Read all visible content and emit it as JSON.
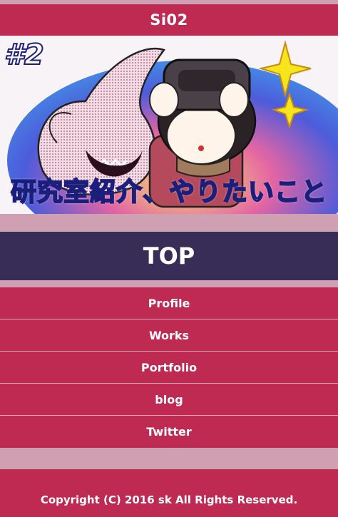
{
  "site": {
    "title": "Si02"
  },
  "banner": {
    "number": "#2",
    "title": "研究室紹介、やりたいこと",
    "alt": "banner illustration"
  },
  "page": {
    "heading": "TOP"
  },
  "nav": {
    "items": [
      {
        "label": "Profile"
      },
      {
        "label": "Works"
      },
      {
        "label": "Portfolio"
      },
      {
        "label": "blog"
      },
      {
        "label": "Twitter"
      }
    ]
  },
  "footer": {
    "copyright": "Copyright (C) 2016 sk All Rights Reserved."
  },
  "colors": {
    "brand": "#be2a52",
    "heading_bg": "#372d56",
    "page_bg": "#cfa0b2"
  }
}
